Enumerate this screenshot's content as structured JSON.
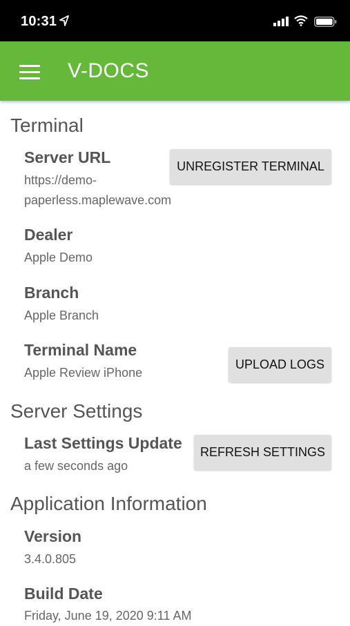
{
  "status": {
    "time": "10:31"
  },
  "app_bar": {
    "title": "V-DOCS"
  },
  "terminal": {
    "heading": "Terminal",
    "server_url_label": "Server URL",
    "server_url_line1": "https://demo-",
    "server_url_line2": "paperless.maplewave.com",
    "unregister_button": "UNREGISTER TERMINAL",
    "dealer_label": "Dealer",
    "dealer_value": "Apple Demo",
    "branch_label": "Branch",
    "branch_value": "Apple Branch",
    "terminal_name_label": "Terminal Name",
    "terminal_name_value": "Apple Review iPhone",
    "upload_logs_button": "UPLOAD LOGS"
  },
  "server_settings": {
    "heading": "Server Settings",
    "last_update_label": "Last Settings Update",
    "last_update_value": "a few seconds ago",
    "refresh_button": "REFRESH SETTINGS"
  },
  "app_info": {
    "heading": "Application Information",
    "version_label": "Version",
    "version_value": "3.4.0.805",
    "build_date_label": "Build Date",
    "build_date_value": "Friday, June 19, 2020 9:11 AM"
  }
}
